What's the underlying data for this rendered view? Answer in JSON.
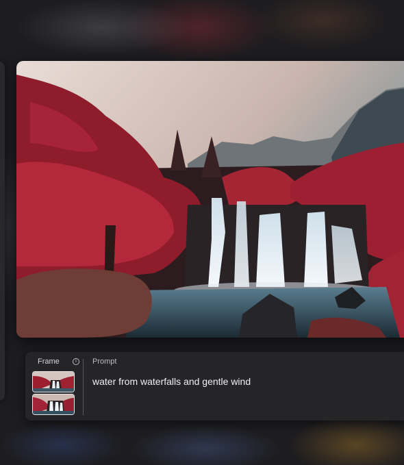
{
  "frame_panel": {
    "label": "Frame",
    "info_icon": "info-icon",
    "thumbnails": [
      "frame-thumbnail-1",
      "frame-thumbnail-2"
    ]
  },
  "prompt_panel": {
    "label": "Prompt",
    "text": "water from waterfalls and gentle wind"
  },
  "colors": {
    "foliage": "#9b1f2e",
    "water": "#4e6e80",
    "panel_bg": "#252427",
    "thumbnail_border": "#e6e6e8"
  }
}
